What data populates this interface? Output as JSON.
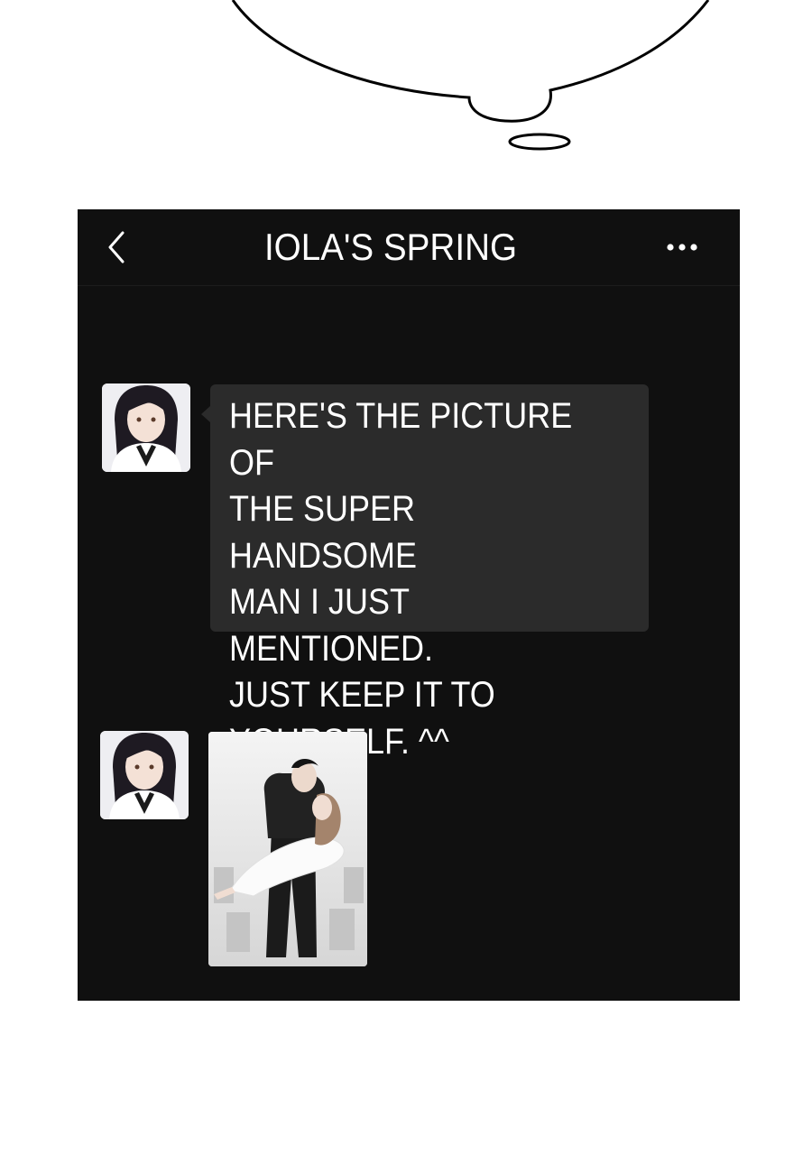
{
  "chat": {
    "title": "IOLA'S SPRING",
    "back_icon": "chevron-left-icon",
    "more_icon": "more-horizontal-icon",
    "messages": [
      {
        "type": "text",
        "text": "HERE'S THE PICTURE OF\nTHE SUPER HANDSOME\nMAN I JUST MENTIONED.\nJUST KEEP IT TO\nYOURSELF. ^^"
      },
      {
        "type": "image",
        "content": "photo of a man carrying a woman in a white dress"
      }
    ]
  },
  "colors": {
    "panel_background": "#101010",
    "bubble_background": "#2b2b2b",
    "text": "#ffffff"
  }
}
